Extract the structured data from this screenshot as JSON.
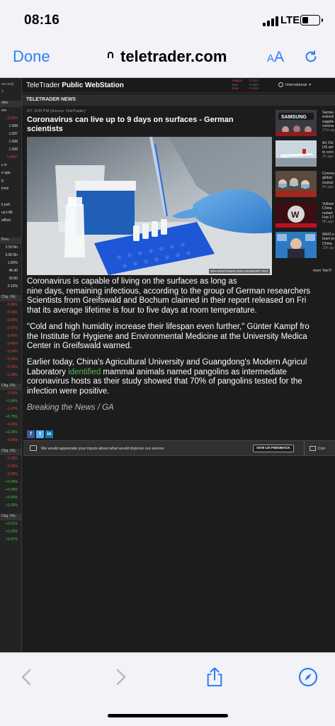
{
  "status": {
    "time": "08:16",
    "network": "LTE",
    "battery_level": 0.4
  },
  "browser": {
    "done_label": "Done",
    "url": "teletrader.com",
    "text_size_label_small": "A",
    "text_size_label_large": "A"
  },
  "site": {
    "brand_light": "TeleTrader",
    "brand_bold": "Public WebStation",
    "tickers": [
      {
        "name": "HangS",
        "change": "-0.31%",
        "color": "#e34040"
      },
      {
        "name": "Dax",
        "change": "-0.46%",
        "color": "#2f80ed"
      },
      {
        "name": "Dow",
        "change": "-0.94%",
        "color": "#e34040"
      }
    ],
    "region": "International",
    "section": "TELETRADER NEWS"
  },
  "article": {
    "meta": "2/7, 8:00 PM (Source: TeleTrader)",
    "headline": "Coronavirus can live up to 9 days on surfaces - German scientists",
    "photo_credit": "EPA-EFE/TAMAS SOKI HUNGARY OUT",
    "p1_lines": [
      "Coronavirus is capable of living on the surfaces as long as",
      "nine days, remaining infectious, according to the group of German researchers",
      "Scientists from Greifswald and Bochum claimed in their report released on Fri",
      "that its average lifetime is four to five days at room temperature."
    ],
    "p2_lines": [
      "\"Cold and high humidity increase their lifespan even further,\" Günter Kampf fro",
      "the Institute for Hygiene and Environmental Medicine at the University Medica",
      "Center in Greifswald warned."
    ],
    "p3_line1": "Earlier today, China's Agricultural University and Guangdong's Modern Agricul",
    "p3_line2_pre": "Laboratory ",
    "p3_link": "identified",
    "p3_line2_post": " mammal animals named pangolins as intermediate",
    "p3_lines_rest": [
      "coronavirus hosts as their study showed that 70% of pangolins tested for the",
      "infection were positive."
    ],
    "signature": "Breaking the News / GA",
    "share": [
      "f",
      "t",
      "in"
    ]
  },
  "feedback": {
    "text": "We would appreciate your inputs about what would improve our service",
    "button": "GIVE US FEEDBACK",
    "contact": "Con"
  },
  "sidebar_news": [
    {
      "lines": [
        "Samsu",
        "extend",
        "supplie",
        "corona"
      ],
      "ago": "27m ag",
      "thumb": "samsung"
    },
    {
      "lines": [
        "Air Chi",
        "US ser",
        "to coro"
      ],
      "ago": "2h ago",
      "thumb": "plane"
    },
    {
      "lines": [
        "Corona",
        "global",
        "surpas"
      ],
      "ago": "5h ago",
      "thumb": "crowd"
    },
    {
      "lines": [
        "Volksw",
        "China",
        "restart",
        "Feb 17"
      ],
      "ago": "9h ago",
      "thumb": "vw"
    },
    {
      "lines": [
        "WHO e",
        "team to",
        "China"
      ],
      "ago": "10h ag",
      "thumb": "who"
    }
  ],
  "more_label": "more TeleTr",
  "left_column": {
    "cells": [
      {
        "t": "ers only",
        "cls": ""
      },
      {
        "t": "Y",
        "cls": ""
      },
      {
        "t": "rites",
        "cls": "lhdr"
      },
      {
        "t": "ers",
        "cls": "wht"
      },
      {
        "t": "-0.29%",
        "cls": "red"
      },
      {
        "t": "1.098",
        "cls": "wht"
      },
      {
        "t": "1.097",
        "cls": "wht"
      },
      {
        "t": "1.098",
        "cls": "wht"
      },
      {
        "t": "1.098",
        "cls": "wht"
      },
      {
        "t": "0.0467",
        "cls": "red"
      },
      {
        "t": "y in",
        "cls": "wht"
      },
      {
        "t": "e ago",
        "cls": "wht"
      },
      {
        "t": "g",
        "cls": "wht"
      },
      {
        "t": "incts",
        "cls": "wht"
      },
      {
        "t": "it poll",
        "cls": "wht"
      },
      {
        "t": "ny's Alt",
        "cls": "wht"
      },
      {
        "t": "etBorl",
        "cls": "wht"
      },
      {
        "t": "Prev.",
        "cls": "lhdr"
      },
      {
        "t": "2.50 Bn",
        "cls": "wht"
      },
      {
        "t": "6.80 Bn",
        "cls": "wht"
      },
      {
        "t": "1.80%",
        "cls": "wht"
      },
      {
        "t": "45.40",
        "cls": "wht"
      },
      {
        "t": "39.80",
        "cls": "wht"
      },
      {
        "t": "0.10%",
        "cls": "wht"
      },
      {
        "t": "Chg. (%)",
        "cls": "lhdr"
      },
      {
        "t": "-0.88%",
        "cls": "red"
      },
      {
        "t": "-0.94%",
        "cls": "red"
      },
      {
        "t": "-0.60%",
        "cls": "red"
      },
      {
        "t": "-0.47%",
        "cls": "red"
      },
      {
        "t": "-0.45%",
        "cls": "red"
      },
      {
        "t": "-0.46%",
        "cls": "red"
      },
      {
        "t": "-0.14%",
        "cls": "red"
      },
      {
        "t": "-0.16%",
        "cls": "red"
      },
      {
        "t": "-0.33%",
        "cls": "red"
      },
      {
        "t": "-0.38%",
        "cls": "red"
      },
      {
        "t": "Chg. (%)",
        "cls": "lhdr"
      },
      {
        "t": "-0.60%",
        "cls": "red"
      },
      {
        "t": "+1.84%",
        "cls": "green"
      },
      {
        "t": "-1.47%",
        "cls": "red"
      },
      {
        "t": "+0.79%",
        "cls": "green"
      },
      {
        "t": "-0.03%",
        "cls": "red"
      },
      {
        "t": "+0.29%",
        "cls": "green"
      },
      {
        "t": "-0.54%",
        "cls": "red"
      },
      {
        "t": "Chg. (%)",
        "cls": "lhdr"
      },
      {
        "t": "-0.29%",
        "cls": "red"
      },
      {
        "t": "-0.32%",
        "cls": "red"
      },
      {
        "t": "-0.20%",
        "cls": "red"
      },
      {
        "t": "+0.26%",
        "cls": "green"
      },
      {
        "t": "+0.06%",
        "cls": "green"
      },
      {
        "t": "+0.80%",
        "cls": "green"
      },
      {
        "t": "+2.02%",
        "cls": "green"
      },
      {
        "t": "Chg. (%)",
        "cls": "lhdr"
      },
      {
        "t": "+0.01%",
        "cls": "green"
      },
      {
        "t": "+0.23%",
        "cls": "green"
      },
      {
        "t": "+0.07%",
        "cls": "green"
      }
    ]
  }
}
